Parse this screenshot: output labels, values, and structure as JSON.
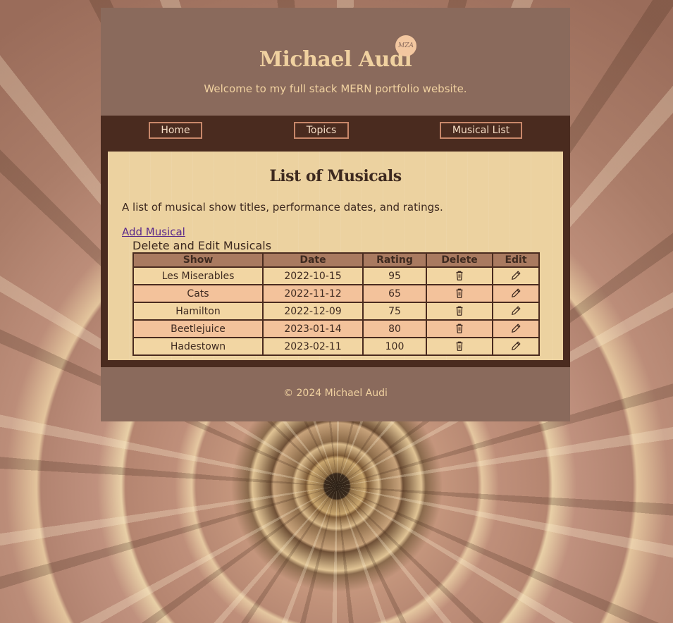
{
  "header": {
    "title": "Michael Audi",
    "logo_text": "MZA",
    "tagline": "Welcome to my full stack MERN portfolio website."
  },
  "nav": {
    "items": [
      {
        "label": "Home"
      },
      {
        "label": "Topics"
      },
      {
        "label": "Musical List"
      }
    ]
  },
  "main": {
    "title": "List of Musicals",
    "description": "A list of musical show titles, performance dates, and ratings.",
    "add_link": "Add Musical",
    "table_caption": "Delete and Edit Musicals",
    "columns": [
      "Show",
      "Date",
      "Rating",
      "Delete",
      "Edit"
    ],
    "rows": [
      {
        "show": "Les Miserables",
        "date": "2022-10-15",
        "rating": "95"
      },
      {
        "show": "Cats",
        "date": "2022-11-12",
        "rating": "65"
      },
      {
        "show": "Hamilton",
        "date": "2022-12-09",
        "rating": "75"
      },
      {
        "show": "Beetlejuice",
        "date": "2023-01-14",
        "rating": "80"
      },
      {
        "show": "Hadestown",
        "date": "2023-02-11",
        "rating": "100"
      }
    ],
    "row_icons": {
      "delete": "trash-icon",
      "edit": "pencil-icon"
    }
  },
  "footer": {
    "copyright": "© 2024 Michael Audi"
  },
  "colors": {
    "panel": "#8a6a5c",
    "nav_bg": "#4a2b1f",
    "accent_text": "#f0d1a0",
    "table_header": "#a97a60",
    "row_odd": "#f2d6a3",
    "row_even": "#f3c29b"
  }
}
